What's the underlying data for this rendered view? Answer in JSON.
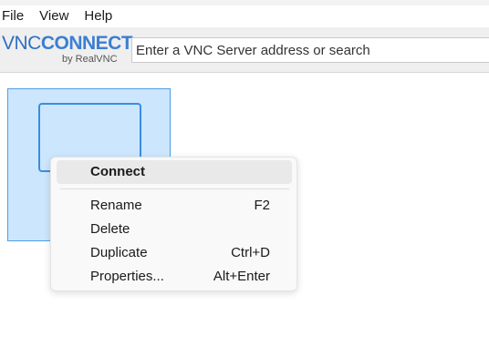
{
  "menubar": {
    "items": [
      {
        "label": "File"
      },
      {
        "label": "View"
      },
      {
        "label": "Help"
      }
    ]
  },
  "toolbar": {
    "logo": {
      "brand_vnc": "VNC",
      "brand_connect": "CONNECT",
      "byline": "by RealVNC",
      "color": "#3b7fd1"
    },
    "search": {
      "placeholder": "Enter a VNC Server address or search",
      "value": ""
    }
  },
  "context_menu": {
    "items": [
      {
        "label": "Connect",
        "shortcut": "",
        "bold": true,
        "highlighted": true
      },
      {
        "label": "Rename",
        "shortcut": "F2"
      },
      {
        "label": "Delete",
        "shortcut": ""
      },
      {
        "label": "Duplicate",
        "shortcut": "Ctrl+D"
      },
      {
        "label": "Properties...",
        "shortcut": "Alt+Enter"
      }
    ]
  },
  "colors": {
    "selection_fill": "#cce6fd",
    "selection_border": "#4d9ee6",
    "toolbar_bg": "#efefef"
  }
}
